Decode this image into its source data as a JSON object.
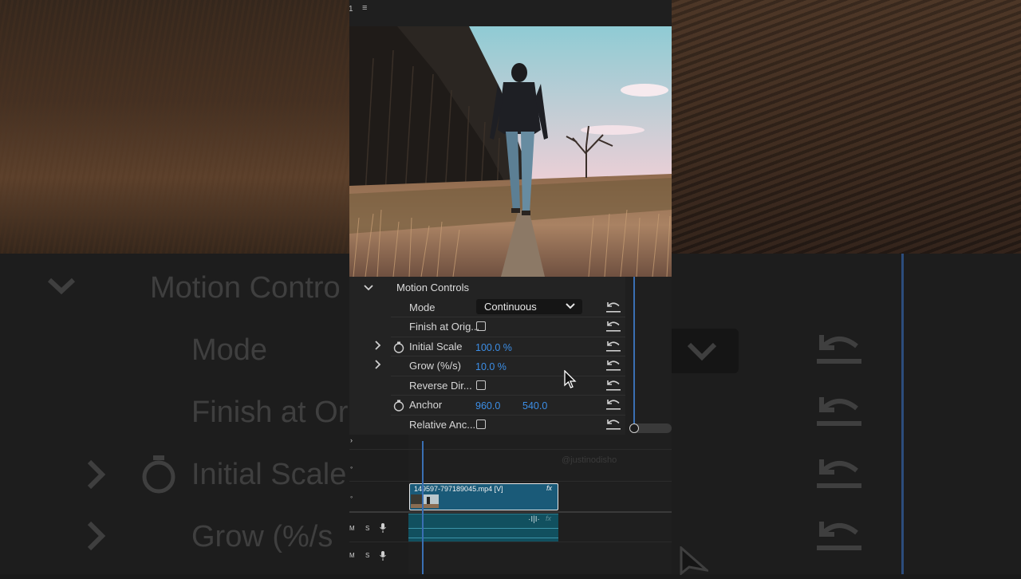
{
  "panel": {
    "track_number": "1",
    "menu_icon": "hamburger-icon"
  },
  "effect_controls": {
    "section_title": "Motion Controls",
    "rows": [
      {
        "label": "Mode",
        "value": "Continuous"
      },
      {
        "label": "Finish at Orig..."
      },
      {
        "label": "Initial Scale",
        "value": "100.0 %"
      },
      {
        "label": "Grow (%/s)",
        "value": "10.0 %"
      },
      {
        "label": "Reverse Dir..."
      },
      {
        "label": "Anchor",
        "value_x": "960.0",
        "value_y": "540.0"
      },
      {
        "label": "Relative Anc..."
      }
    ]
  },
  "timeline": {
    "watermark": "@justinodisho",
    "video_clip_name": "149597-797189045.mp4 [V]",
    "fx_badge": "fx",
    "audio_fx_badge": "fx",
    "track_m_label": "M",
    "track_s_label": "S"
  },
  "ghost": {
    "motion_title": "Motion Contro",
    "mode": "Mode",
    "finish": "Finish at Or",
    "initial_scale": "Initial Scale",
    "grow": "Grow (%/s"
  },
  "colors": {
    "accent_blue": "#3c8ee6",
    "clip_video": "#1a5a78",
    "clip_audio": "#11505f",
    "playhead": "#3a6fb3",
    "panel_bg": "#232323"
  }
}
